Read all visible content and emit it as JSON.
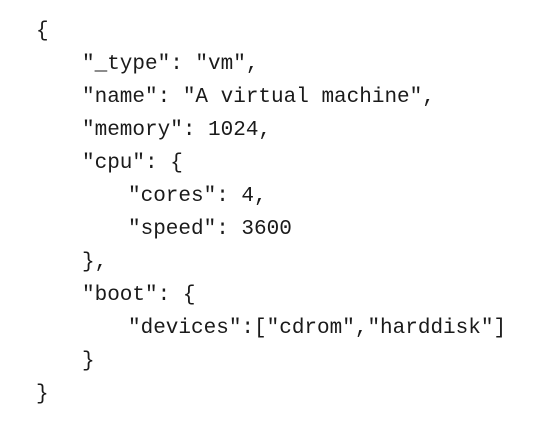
{
  "lines": [
    "{",
    "\"_type\": \"vm\",",
    "\"name\": \"A virtual machine\",",
    "\"memory\": 1024,",
    "\"cpu\": {",
    "\"cores\": 4,",
    "\"speed\": 3600",
    "},",
    "\"boot\": {",
    "\"devices\":[\"cdrom\",\"harddisk\"]",
    "}",
    "}"
  ]
}
